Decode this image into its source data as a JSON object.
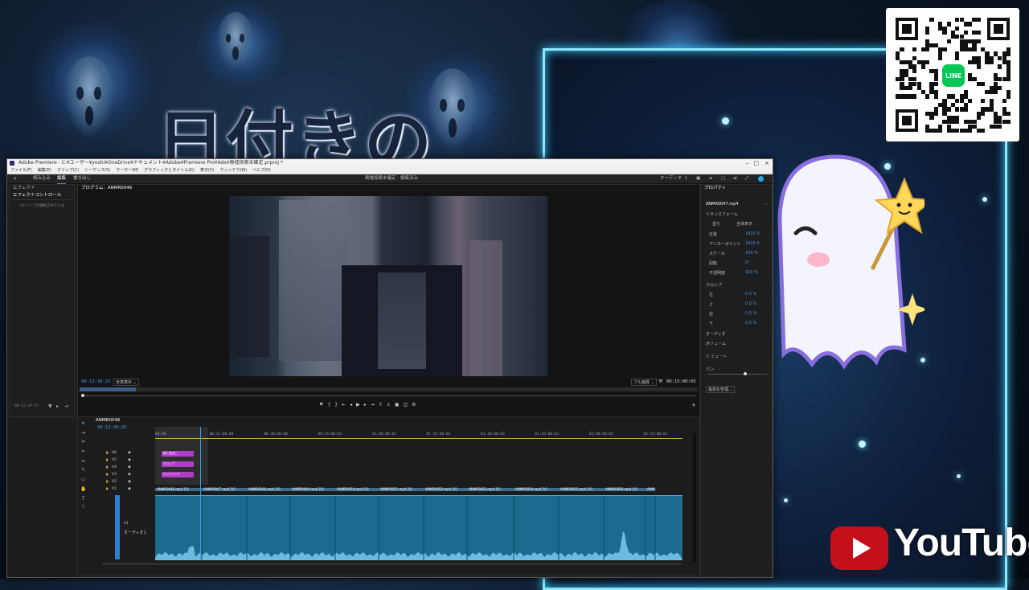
{
  "overlay": {
    "title_text": "日付きの",
    "youtube_text": "YouTube",
    "line_badge": "LINE"
  },
  "window": {
    "title": "Adobe Premiere - C:¥ユーザー¥yoshi¥OneDrive¥ドキュメント¥Adobe¥Premiere Pro¥Ads¥廃墟探索未確定.prproj *",
    "menus": [
      "ファイル(F)",
      "編集(E)",
      "クリップ(C)",
      "シーケンス(S)",
      "マーカー(M)",
      "グラフィックとタイトル(G)",
      "表示(V)",
      "ウィンドウ(W)",
      "ヘルプ(H)"
    ],
    "workspace_tabs": [
      "読み込み",
      "編集",
      "書き出し"
    ],
    "center_title": "廃墟探索未確定 - 編集済み",
    "audio_label": "オーディオ"
  },
  "left_panel": {
    "tabs": [
      "エフェクト",
      "エフェクトコントロール"
    ],
    "placeholder": "（クリップが選択されていま",
    "time": "00:12:39:25"
  },
  "program": {
    "tab": "プログラム：ANMR0046",
    "timecode": "00:12:39:25",
    "fit": "全体表示",
    "quality": "フル画質",
    "duration": "00:15:00:03"
  },
  "properties": {
    "title": "プロパティ",
    "clip": "ANMR0047.mp4",
    "transform": "トランスフォーム",
    "fit_labels": [
      "塗り",
      "全体表示"
    ],
    "rows": [
      {
        "label": "位置",
        "value": "1920 X"
      },
      {
        "label": "アンカーポイント",
        "value": "1920 X"
      },
      {
        "label": "スケール",
        "value": "100 %"
      },
      {
        "label": "回転",
        "value": "0°"
      },
      {
        "label": "不透明度",
        "value": "100 %"
      }
    ],
    "crop": "クロップ",
    "crop_rows": [
      {
        "label": "左",
        "value": "0.0 %"
      },
      {
        "label": "上",
        "value": "0.0 %"
      },
      {
        "label": "右",
        "value": "0.0 %"
      },
      {
        "label": "下",
        "value": "0.0 %"
      }
    ],
    "audio": "オーディオ",
    "volume": "ボリューム",
    "mute": "ミュート",
    "pan": "パン",
    "more": "最高を管理..."
  },
  "timeline": {
    "sequence": "ANMR0046",
    "timecode": "00:12:39:25",
    "ruler": [
      "00:00",
      "00:15:00:00",
      "00:30:00:00",
      "00:45:00:03",
      "01:00:00:03",
      "01:15:00:03",
      "01:30:00:03",
      "01:45:00:03",
      "02:00:00:03",
      "02:15:00:03"
    ],
    "tracks_video": [
      "V6",
      "V5",
      "V4",
      "V3",
      "V2",
      "V1"
    ],
    "tracks_audio": [
      "A1"
    ],
    "audio_track_name": "オーディオ1",
    "purple_clips": [
      "輝く見出し",
      "テロップ",
      "エンディング"
    ],
    "video_clips": [
      "ANMR0046.mp4 [V]",
      "ANMR0047.mp4 [V]",
      "ANMR0048.mp4 [V]",
      "ANMR0049.mp4 [V]",
      "ANMR0050.mp4 [V]",
      "ANMR0051.mp4 [V]",
      "ANMR0052.mp4 [V]",
      "ANMR0053.mp4 [V]",
      "ANMR0054.mp4 [V]",
      "ANMR0055.mp4 [V]",
      "ANMR0056.mp4 [V]",
      "ANMR"
    ]
  }
}
